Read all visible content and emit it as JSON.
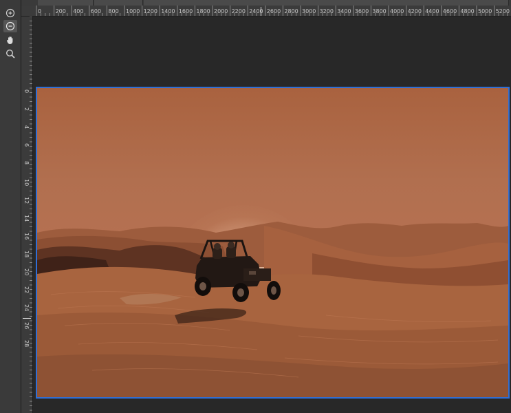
{
  "tools": [
    {
      "name": "zoom-in-icon",
      "active": false
    },
    {
      "name": "zoom-out-icon",
      "active": true
    },
    {
      "name": "hand-icon",
      "active": false
    },
    {
      "name": "magnifier-icon",
      "active": false
    }
  ],
  "ruler_top": {
    "labels": [
      "0",
      "200",
      "400",
      "600",
      "800",
      "1000",
      "1200",
      "1400",
      "1600",
      "1800",
      "2000",
      "2200",
      "2400",
      "2600",
      "2800",
      "3000",
      "3200",
      "3400",
      "3600",
      "3800",
      "4000",
      "4200",
      "4400",
      "4600",
      "4800",
      "5000",
      "5200"
    ]
  },
  "ruler_left": {
    "labels": [
      "0",
      "2",
      "4",
      "6",
      "8",
      "10",
      "12",
      "14",
      "16",
      "18",
      "20",
      "22",
      "24",
      "26",
      "28"
    ]
  },
  "canvas": {
    "selection_color": "#2f6fd6",
    "image_description": "desert dunes with buggy"
  }
}
